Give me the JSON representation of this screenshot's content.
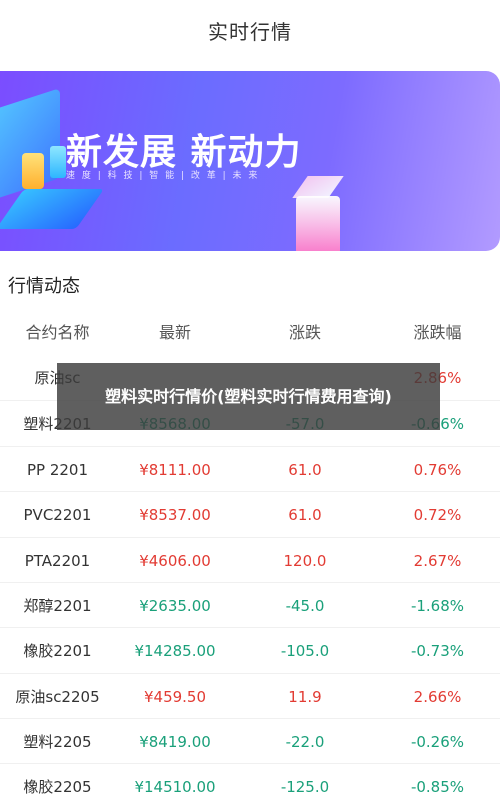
{
  "page": {
    "title": "实时行情"
  },
  "banner": {
    "slogan": "新发展 新动力",
    "subline": "速 度 | 科 技 | 智 能 | 改 革 | 未 来"
  },
  "section": {
    "title": "行情动态"
  },
  "table": {
    "headers": [
      "合约名称",
      "最新",
      "涨跌",
      "涨跌幅"
    ],
    "rows": [
      {
        "name": "原油sc",
        "price": "",
        "change": "",
        "pct": "2.86%",
        "trend": "up"
      },
      {
        "name": "塑料2201",
        "price": "¥8568.00",
        "change": "-57.0",
        "pct": "-0.66%",
        "trend": "down"
      },
      {
        "name": "PP 2201",
        "price": "¥8111.00",
        "change": "61.0",
        "pct": "0.76%",
        "trend": "up"
      },
      {
        "name": "PVC2201",
        "price": "¥8537.00",
        "change": "61.0",
        "pct": "0.72%",
        "trend": "up"
      },
      {
        "name": "PTA2201",
        "price": "¥4606.00",
        "change": "120.0",
        "pct": "2.67%",
        "trend": "up"
      },
      {
        "name": "郑醇2201",
        "price": "¥2635.00",
        "change": "-45.0",
        "pct": "-1.68%",
        "trend": "down"
      },
      {
        "name": "橡胶2201",
        "price": "¥14285.00",
        "change": "-105.0",
        "pct": "-0.73%",
        "trend": "down"
      },
      {
        "name": "原油sc2205",
        "price": "¥459.50",
        "change": "11.9",
        "pct": "2.66%",
        "trend": "up"
      },
      {
        "name": "塑料2205",
        "price": "¥8419.00",
        "change": "-22.0",
        "pct": "-0.26%",
        "trend": "down"
      },
      {
        "name": "橡胶2205",
        "price": "¥14510.00",
        "change": "-125.0",
        "pct": "-0.85%",
        "trend": "down"
      }
    ]
  },
  "overlay": {
    "text": "塑料实时行情价(塑料实时行情费用查询)"
  },
  "colors": {
    "up": "#e23b33",
    "down": "#1aa07a",
    "banner_from": "#7b4dff",
    "banner_to": "#b29bff"
  }
}
